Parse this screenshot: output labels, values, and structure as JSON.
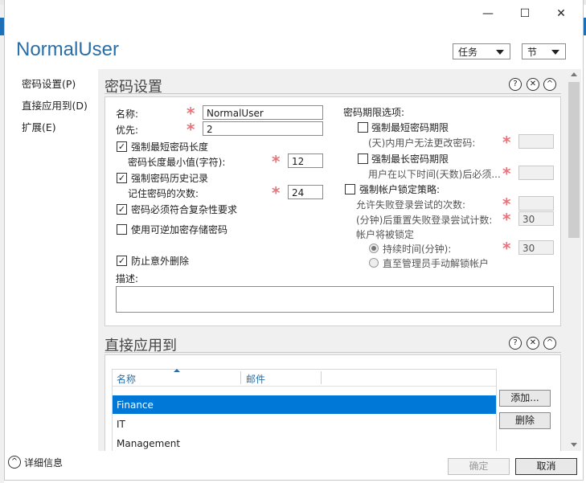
{
  "window": {
    "title": "NormalUser",
    "minimize_glyph": "—",
    "maximize_glyph": "☐",
    "close_glyph": "✕"
  },
  "header": {
    "tasks_label": "任务",
    "sections_label": "节"
  },
  "sidebar": {
    "items": [
      {
        "label": "密码设置(P)"
      },
      {
        "label": "直接应用到(D)"
      },
      {
        "label": "扩展(E)"
      }
    ]
  },
  "password_section": {
    "title": "密码设置",
    "help_glyph": "?",
    "close_glyph": "✕",
    "collapse_glyph": "^",
    "name_label": "名称:",
    "name_value": "NormalUser",
    "priority_label": "优先:",
    "priority_value": "2",
    "enforce_min_length_label": "强制最短密码长度",
    "enforce_min_length_checked": true,
    "min_length_label": "密码长度最小值(字符):",
    "min_length_value": "12",
    "enforce_history_label": "强制密码历史记录",
    "enforce_history_checked": true,
    "history_count_label": "记住密码的次数:",
    "history_count_value": "24",
    "complexity_label": "密码必须符合复杂性要求",
    "complexity_checked": true,
    "reversible_label": "使用可逆加密存储密码",
    "reversible_checked": false,
    "protect_deletion_label": "防止意外删除",
    "protect_deletion_checked": true,
    "description_label": "描述:",
    "description_value": "",
    "age_options_label": "密码期限选项:",
    "enforce_min_age_label": "强制最短密码期限",
    "enforce_min_age_checked": false,
    "min_age_label": "(天)内用户无法更改密码:",
    "min_age_value": "",
    "enforce_max_age_label": "强制最长密码期限",
    "enforce_max_age_checked": false,
    "max_age_label": "用户在以下时间(天数)后必须...",
    "max_age_value": "",
    "lockout_label": "强制帐户锁定策略:",
    "lockout_checked": false,
    "failed_attempts_label": "允许失败登录尝试的次数:",
    "failed_attempts_value": "",
    "reset_after_label": "(分钟)后重置失败登录尝试计数:",
    "reset_after_value": "30",
    "lockout_mode_label": "帐户将被锁定",
    "duration_label": "持续时间(分钟):",
    "duration_value": "30",
    "duration_selected": true,
    "until_unlock_label": "直至管理员手动解锁帐户",
    "until_unlock_selected": false
  },
  "applies_section": {
    "title": "直接应用到",
    "help_glyph": "?",
    "close_glyph": "✕",
    "collapse_glyph": "^",
    "columns": [
      "名称",
      "邮件"
    ],
    "rows": [
      {
        "name": "Finance",
        "mail": "",
        "selected": true
      },
      {
        "name": "IT",
        "mail": "",
        "selected": false
      },
      {
        "name": "Management",
        "mail": "",
        "selected": false
      }
    ],
    "add_label": "添加...",
    "remove_label": "删除"
  },
  "footer": {
    "details_glyph": "^",
    "details_label": "详细信息",
    "ok_label": "确定",
    "cancel_label": "取消"
  },
  "colors": {
    "accent": "#0078d7",
    "title_blue": "#2a6ea8",
    "required_star": "#e8747c"
  }
}
